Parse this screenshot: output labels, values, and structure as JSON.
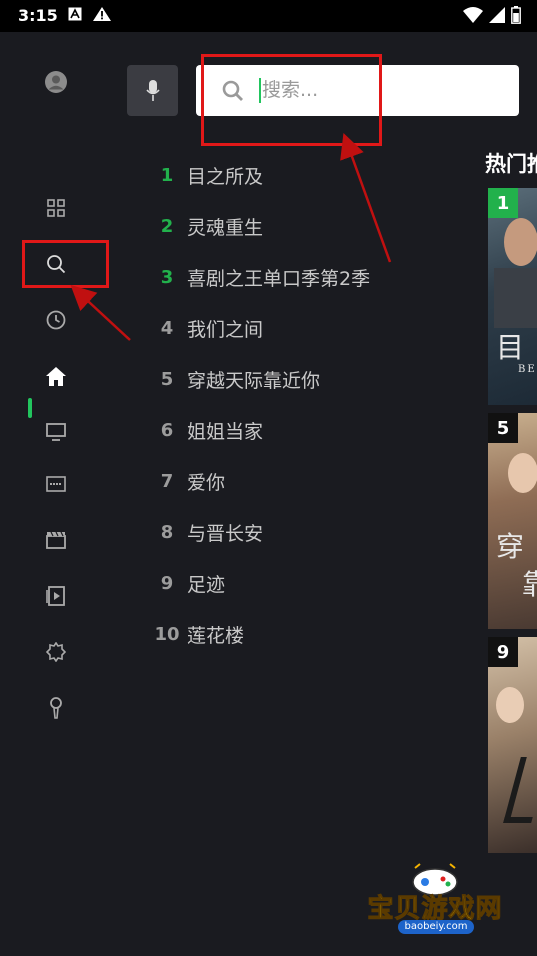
{
  "status_bar": {
    "time": "3:15",
    "icons": [
      "font-a-icon",
      "warning-icon",
      "wifi-icon",
      "signal-icon",
      "battery-icon"
    ]
  },
  "sidebar": {
    "items": [
      {
        "name": "avatar",
        "icon": "user-icon"
      },
      {
        "name": "apps",
        "icon": "grid-icon"
      },
      {
        "name": "search",
        "icon": "search-icon"
      },
      {
        "name": "history",
        "icon": "clock-icon"
      },
      {
        "name": "home",
        "icon": "home-icon",
        "active": true
      },
      {
        "name": "tv",
        "icon": "tv-icon"
      },
      {
        "name": "free",
        "icon": "free-icon"
      },
      {
        "name": "movies",
        "icon": "clapperboard-icon"
      },
      {
        "name": "short-video",
        "icon": "play-icon"
      },
      {
        "name": "settings",
        "icon": "gear-icon"
      },
      {
        "name": "karaoke",
        "icon": "microphone-icon"
      }
    ],
    "accent": "#22c55e"
  },
  "search": {
    "placeholder": "搜索...",
    "value": ""
  },
  "hot_list": {
    "items": [
      {
        "rank": "1",
        "title": "目之所及"
      },
      {
        "rank": "2",
        "title": "灵魂重生"
      },
      {
        "rank": "3",
        "title": "喜剧之王单口季第2季"
      },
      {
        "rank": "4",
        "title": "我们之间"
      },
      {
        "rank": "5",
        "title": "穿越天际靠近你"
      },
      {
        "rank": "6",
        "title": "姐姐当家"
      },
      {
        "rank": "7",
        "title": "爱你"
      },
      {
        "rank": "8",
        "title": "与晋长安"
      },
      {
        "rank": "9",
        "title": "足迹"
      },
      {
        "rank": "10",
        "title": "莲花楼"
      }
    ]
  },
  "right_panel": {
    "title": "热门推",
    "posters": [
      {
        "rank": "1",
        "text": "目",
        "subtext": "BE"
      },
      {
        "rank": "5",
        "text": "穿",
        "subtext": "靠"
      },
      {
        "rank": "9",
        "text": "",
        "subtext": ""
      }
    ]
  },
  "watermark": {
    "text": "宝贝游戏网",
    "url": "baobeiy.com"
  },
  "colors": {
    "background": "#1a1b20",
    "rank_top": "#22b14c",
    "annotation": "#e01818"
  }
}
